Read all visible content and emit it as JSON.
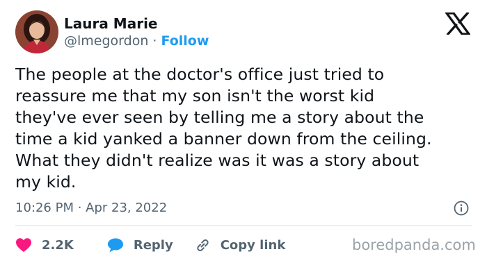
{
  "author": {
    "name": "Laura Marie",
    "handle": "@lmegordon",
    "separator": " · ",
    "follow_label": "Follow"
  },
  "tweet": {
    "lines": [
      "The people at the doctor's office just tried to",
      "reassure me that my son isn't the worst kid",
      "they've ever seen by telling me a story about the",
      "time a kid yanked a banner down from the ceiling.",
      "What they didn't realize was it was a story about",
      "my kid."
    ],
    "timestamp": "10:26 PM · Apr 23, 2022"
  },
  "actions": {
    "like_count": "2.2K",
    "reply_label": "Reply",
    "copy_link_label": "Copy link"
  },
  "icons": {
    "platform": "x-logo-icon",
    "info": "info-icon",
    "like": "heart-icon",
    "reply": "speech-bubble-icon",
    "copy": "link-icon"
  },
  "colors": {
    "like": "#f91880",
    "reply": "#1d9bf0",
    "follow": "#1d9bf0",
    "text_secondary": "#536471"
  },
  "watermark": "boredpanda.com"
}
